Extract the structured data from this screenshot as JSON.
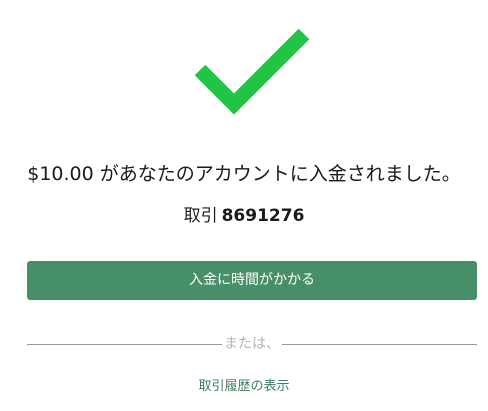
{
  "success": {
    "icon": "checkmark-icon",
    "color": "#22c445"
  },
  "message": {
    "text": "$10.00 があなたのアカウントに入金されました。"
  },
  "transaction": {
    "label": "取引",
    "number": "8691276"
  },
  "actions": {
    "primary_label": "入金に時間がかかる",
    "primary_color": "#478f68",
    "or_text": "または、",
    "history_link": "取引履歴の表示"
  }
}
